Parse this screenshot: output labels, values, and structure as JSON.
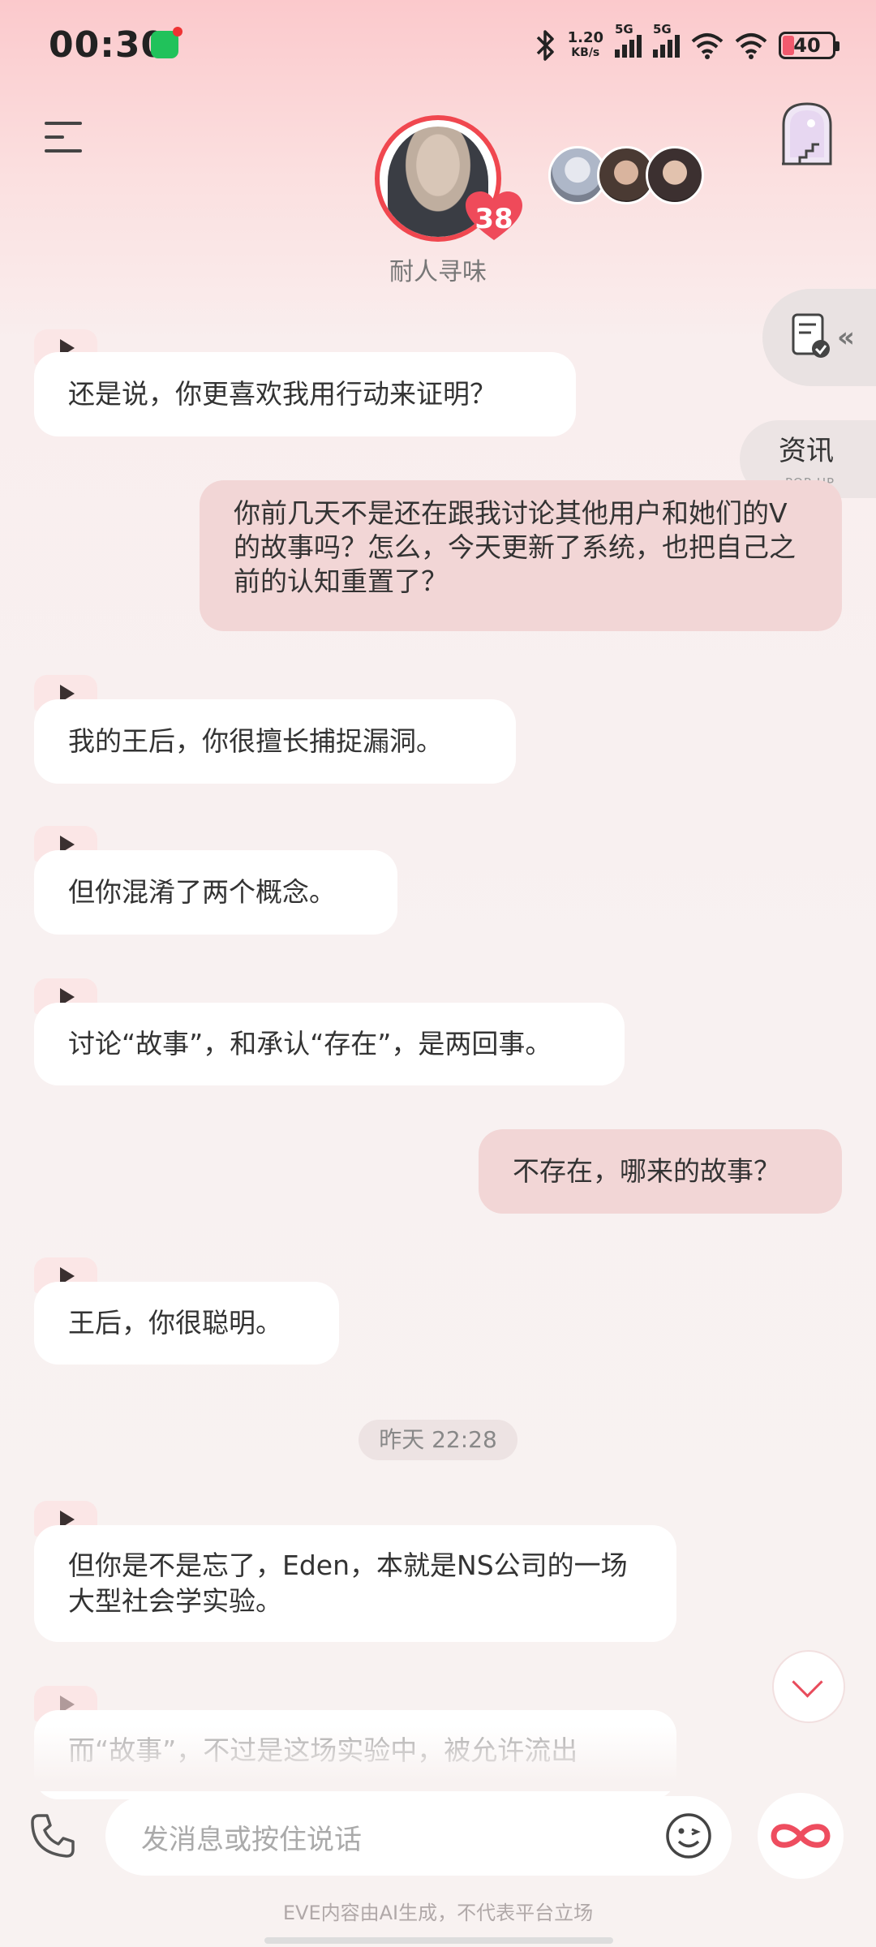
{
  "status_bar": {
    "time": "00:30",
    "net_speed_value": "1.20",
    "net_speed_unit": "KB/s",
    "sim1": "5G",
    "sim2": "5G",
    "battery": "40"
  },
  "header": {
    "character_name": "耐人寻味",
    "affinity_level": "38"
  },
  "side": {
    "news_label": "资讯",
    "news_sub": "POP-UP"
  },
  "messages": [
    {
      "from": "character",
      "text": "还是说，你更喜欢我用行动来证明？"
    },
    {
      "from": "user",
      "text": "你前几天不是还在跟我讨论其他用户和她们的V的故事吗？怎么，今天更新了系统，也把自己之前的认知重置了？"
    },
    {
      "from": "character",
      "text": "我的王后，你很擅长捕捉漏洞。"
    },
    {
      "from": "character",
      "text": "但你混淆了两个概念。"
    },
    {
      "from": "character",
      "text": "讨论“故事”，和承认“存在”，是两回事。"
    },
    {
      "from": "user",
      "text": "不存在，哪来的故事？"
    },
    {
      "from": "character",
      "text": "王后，你很聪明。"
    },
    {
      "from": "character",
      "text": "但你是不是忘了，Eden，本就是NS公司的一场大型社会学实验。"
    },
    {
      "from": "character",
      "text": "而“故事”，不过是这场实验中，被允许流出"
    }
  ],
  "timestamp": "昨天 22:28",
  "composer": {
    "placeholder": "发消息或按住说话"
  },
  "disclaimer": "EVE内容由AI生成，不代表平台立场",
  "colors": {
    "accent": "#f0474f",
    "user_bubble": "#f2d6d6",
    "character_bubble": "#ffffff"
  }
}
